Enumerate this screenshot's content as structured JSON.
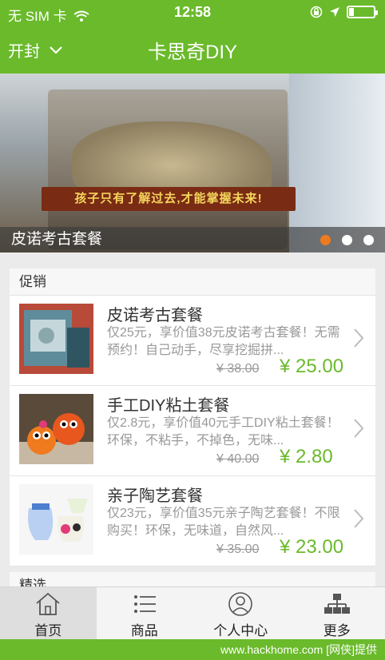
{
  "status": {
    "carrier": "无 SIM 卡",
    "time": "12:58"
  },
  "nav": {
    "city": "开封",
    "title": "卡思奇DIY"
  },
  "banner": {
    "slogan": "孩子只有了解过去,才能掌握未来!",
    "caption": "皮诺考古套餐",
    "active_dot": 0,
    "dot_count": 3
  },
  "promo": {
    "heading": "促销",
    "items": [
      {
        "name": "皮诺考古套餐",
        "desc": "仅25元，享价值38元皮诺考古套餐！无需预约！自己动手，尽享挖掘拼...",
        "old_price": "¥ 38.00",
        "price": "¥ 25.00"
      },
      {
        "name": "手工DIY粘土套餐",
        "desc": "仅2.8元，享价值40元手工DIY粘土套餐！环保，不粘手，不掉色，无味...",
        "old_price": "¥ 40.00",
        "price": "¥ 2.80"
      },
      {
        "name": "亲子陶艺套餐",
        "desc": "仅23元，享价值35元亲子陶艺套餐！不限购买！环保，无味道，自然风...",
        "old_price": "¥ 35.00",
        "price": "¥ 23.00"
      }
    ]
  },
  "next_section": "精选",
  "tabs": [
    {
      "label": "首页",
      "icon": "home-icon"
    },
    {
      "label": "商品",
      "icon": "list-icon"
    },
    {
      "label": "个人中心",
      "icon": "user-icon"
    },
    {
      "label": "更多",
      "icon": "sitemap-icon"
    }
  ],
  "watermark": "www.hackhome.com [网侠]提供",
  "colors": {
    "brand_green": "#6aba2b",
    "dot_active": "#f07a1e"
  }
}
